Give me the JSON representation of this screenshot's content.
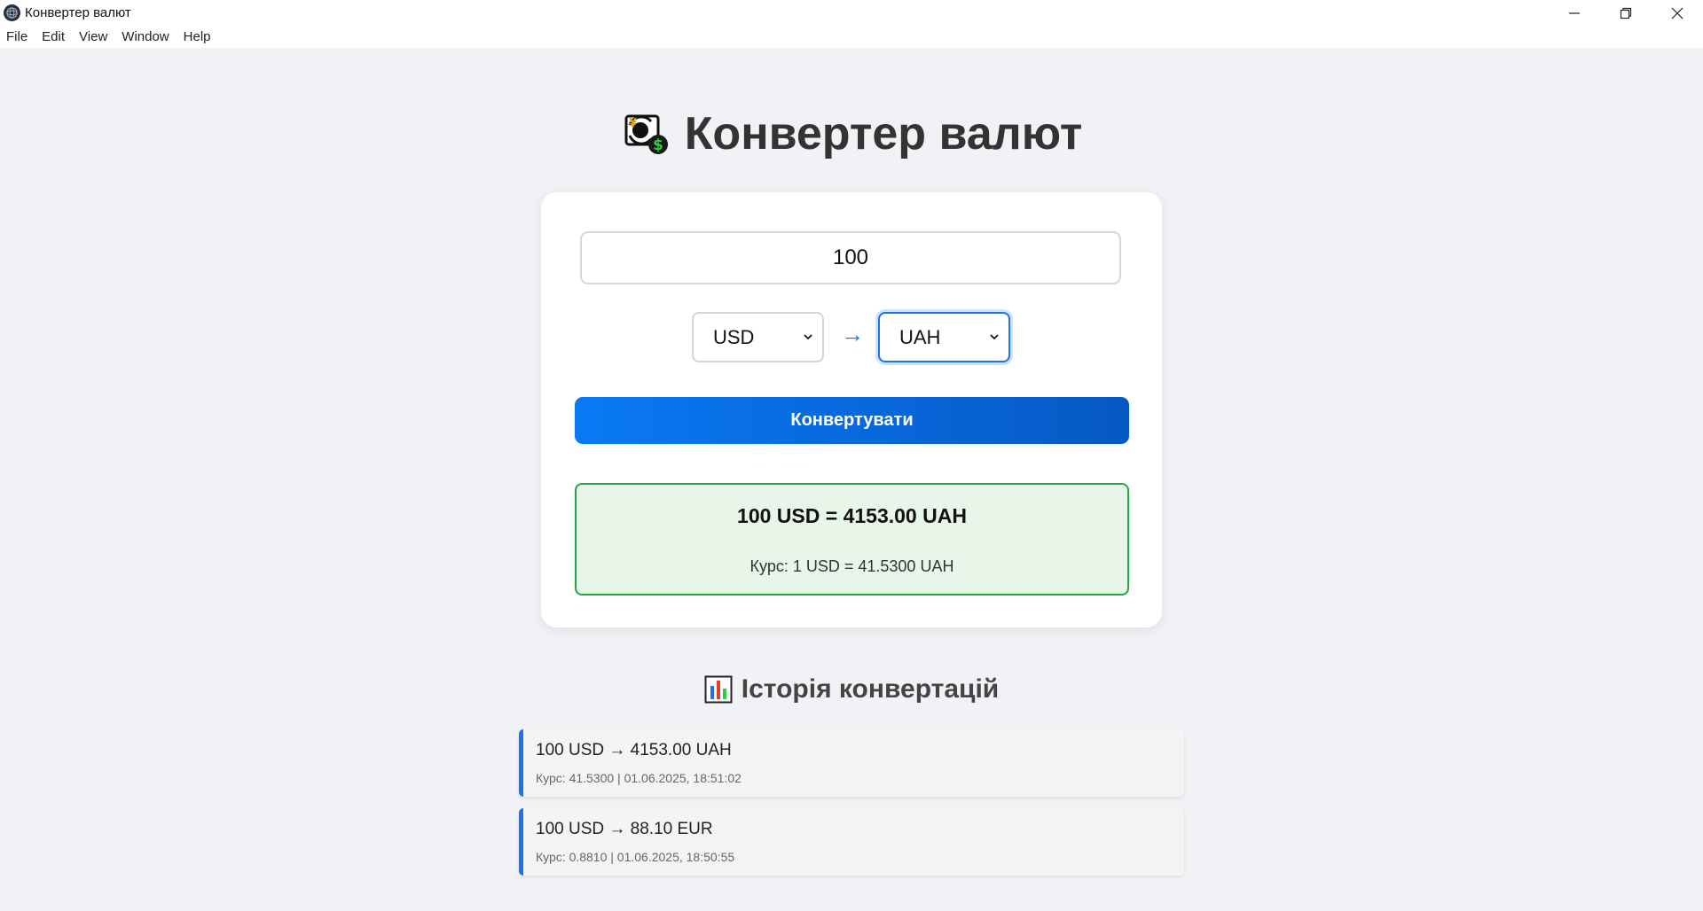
{
  "window": {
    "title": "Конвертер валют",
    "menu": [
      "File",
      "Edit",
      "View",
      "Window",
      "Help"
    ]
  },
  "header": {
    "title": "Конвертер валют",
    "icon": "currency-exchange-icon"
  },
  "converter": {
    "amount": "100",
    "from_currency": "USD",
    "to_currency": "UAH",
    "arrow": "→",
    "convert_label": "Конвертувати"
  },
  "result": {
    "main": "100 USD = 4153.00 UAH",
    "rate": "Курс: 1 USD = 41.5300 UAH"
  },
  "history": {
    "title": "Історія конвертацій",
    "icon": "bar-chart-icon",
    "items": [
      {
        "main": "100 USD → 4153.00 UAH",
        "sub": "Курс: 41.5300 | 01.06.2025, 18:51:02"
      },
      {
        "main": "100 USD → 88.10 EUR",
        "sub": "Курс: 0.8810 | 01.06.2025, 18:50:55"
      }
    ]
  },
  "colors": {
    "accent": "#1a73e8",
    "success": "#28a745",
    "background": "#f0f2f5"
  }
}
